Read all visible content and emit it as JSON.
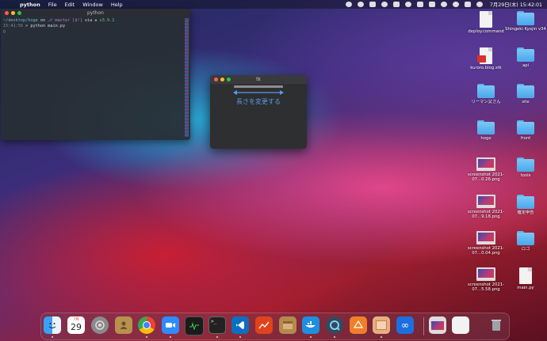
{
  "menubar": {
    "app_name": "python",
    "menus": [
      "File",
      "Edit",
      "Window",
      "Help"
    ],
    "clock": "7月29日(木) 15:42:01"
  },
  "terminal": {
    "title": "python",
    "line1": {
      "path": "~/desktop/hoge",
      "on": "on",
      "branch": "master [$!]",
      "via": "via",
      "version": "v3.9.1"
    },
    "line2": {
      "time": "15:41:56",
      "command": "> python main.py"
    }
  },
  "tk_window": {
    "title": "tk",
    "label": "長さを変更する"
  },
  "desktop_icons": [
    {
      "label": "deploy.command",
      "kind": "doc"
    },
    {
      "label": "Shingeki Kyojin v34",
      "kind": "folder"
    },
    {
      "label": "kuroro.blog.stk",
      "kind": "doc-red"
    },
    {
      "label": "api",
      "kind": "folder"
    },
    {
      "label": "リーマン父さん",
      "kind": "folder"
    },
    {
      "label": "site",
      "kind": "folder"
    },
    {
      "label": "hoge",
      "kind": "folder"
    },
    {
      "label": "front",
      "kind": "folder"
    },
    {
      "label": "screenshot 2021-07...0.26.png",
      "kind": "shot"
    },
    {
      "label": "tools",
      "kind": "folder"
    },
    {
      "label": "screenshot 2021-07...9.18.png",
      "kind": "shot"
    },
    {
      "label": "確定申告",
      "kind": "folder"
    },
    {
      "label": "screenshot 2021-07...0.04.png",
      "kind": "shot"
    },
    {
      "label": "ロゴ",
      "kind": "folder"
    },
    {
      "label": "screenshot 2021-07...5.58.png",
      "kind": "shot"
    },
    {
      "label": "main.py",
      "kind": "doc"
    }
  ],
  "dock": {
    "calendar_month": "7月",
    "calendar_day": "29",
    "items": [
      "finder",
      "calendar",
      "system-preferences",
      "contacts",
      "chrome",
      "zoom",
      "activity-monitor",
      "terminal",
      "vscode",
      "monitor",
      "archive",
      "docker",
      "quicktime",
      "sourcetree",
      "preview",
      "infinity",
      "screenshot",
      "document",
      "trash"
    ]
  }
}
